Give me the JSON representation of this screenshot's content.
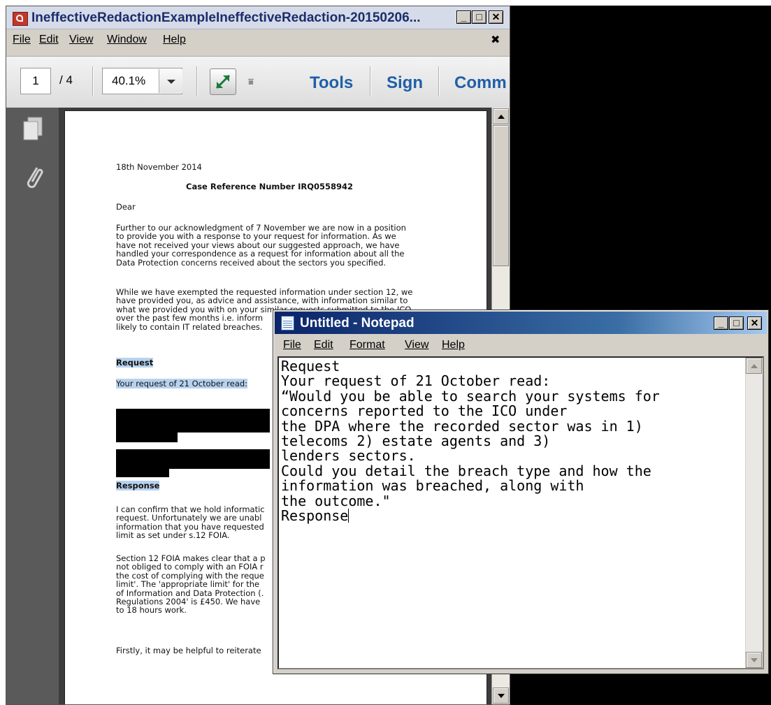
{
  "reader": {
    "title": "IneffectiveRedactionExampleIneffectiveRedaction-20150206...",
    "menu": [
      "File",
      "Edit",
      "View",
      "Window",
      "Help"
    ],
    "close_menu_glyph": "✖",
    "page_current": "1",
    "page_total": "/ 4",
    "zoom": "40.1%",
    "tools_label": "Tools",
    "sign_label": "Sign",
    "comment_label": "Comm"
  },
  "document": {
    "date": "18th November 2014",
    "heading": "Case Reference Number IRQ0558942",
    "salutation": "Dear",
    "para1": [
      "Further to our acknowledgment of 7 November we are now in a position",
      "to provide you with a response to your request for information. As we",
      "have not received your views about our suggested approach, we have",
      "handled your correspondence as a request for information about all the",
      "Data Protection concerns received about the sectors you specified."
    ],
    "para2": [
      "While we have exempted the requested information under section 12, we",
      "have provided you, as advice and assistance, with information similar to",
      "what we provided you with on your similar requests submitted to the ICO",
      "over the past few months i.e. inform",
      "likely to contain IT related breaches."
    ],
    "request_heading": "Request",
    "request_line": "Your request of 21 October read:",
    "response_heading": "Response",
    "para3": [
      "I can confirm that we hold informatic",
      "request. Unfortunately we are unabl",
      "information that you have requested",
      "limit as set under s.12 FOIA."
    ],
    "para4": [
      "Section 12 FOIA makes clear that a p",
      "not obliged to comply with an FOIA r",
      "the cost of complying with the reque",
      "limit'.  The 'appropriate limit' for the",
      "of Information and Data Protection (.",
      "Regulations 2004' is £450.  We have",
      "to 18 hours work."
    ],
    "para5": "Firstly, it may be helpful to reiterate"
  },
  "notepad": {
    "title": "Untitled - Notepad",
    "menu": [
      "File",
      "Edit",
      "Format",
      "View",
      "Help"
    ],
    "content_lines": [
      "Request",
      "Your request of 21 October read:",
      "“Would you be able to search your systems for",
      "concerns reported to the ICO under",
      "the DPA where the recorded sector was in 1)",
      "telecoms 2) estate agents and 3)",
      "lenders sectors.",
      "Could you detail the breach type and how the",
      "information was breached, along with",
      "the outcome.\"",
      "Response"
    ]
  },
  "colors": {
    "notepad_title_start": "#0a246a",
    "highlight": "#b7d2ee",
    "toolbar_text": "#1f5fa8"
  }
}
